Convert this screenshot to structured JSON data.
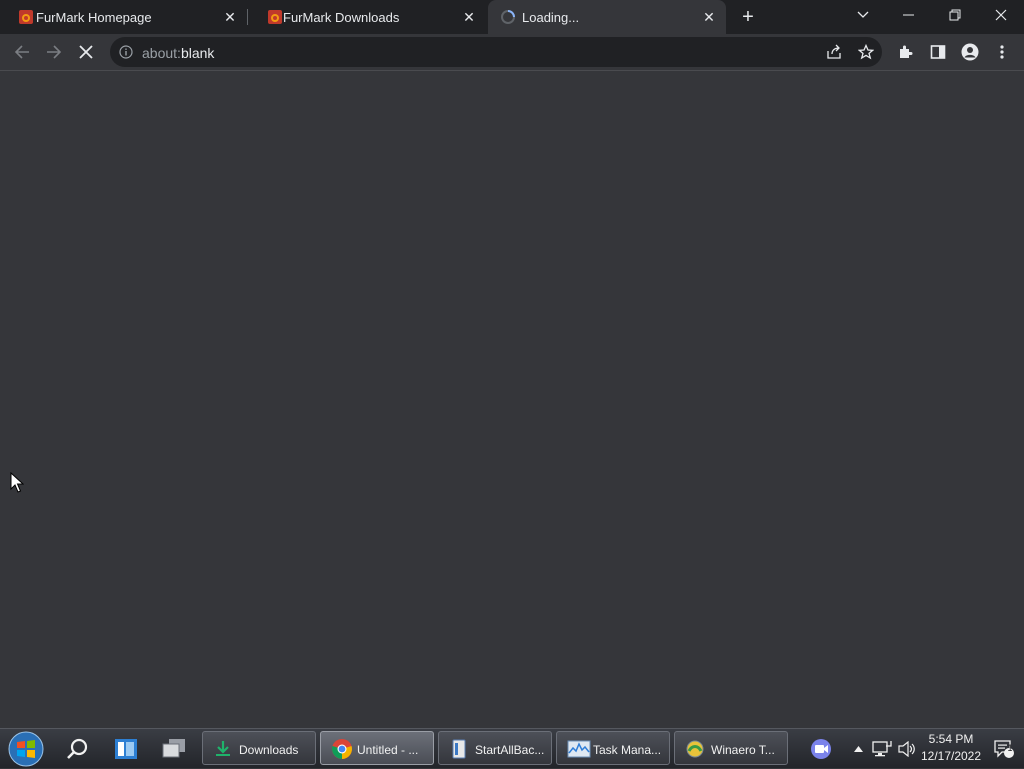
{
  "browser": {
    "tabs": [
      {
        "title": "FurMark Homepage",
        "state": "loaded"
      },
      {
        "title": "FurMark Downloads",
        "state": "loaded"
      },
      {
        "title": "Loading...",
        "state": "loading",
        "active": true
      }
    ],
    "address": {
      "scheme": "about:",
      "rest": "blank"
    },
    "colors": {
      "frame": "#202124",
      "toolbar": "#35363a",
      "text": "#e8eaed"
    }
  },
  "taskbar": {
    "apps": [
      {
        "label": "Downloads",
        "icon": "download-folder-icon"
      },
      {
        "label": "Untitled - ...",
        "icon": "chrome-icon",
        "active": true
      },
      {
        "label": "StartAllBac...",
        "icon": "startallback-icon"
      },
      {
        "label": "Task Mana...",
        "icon": "task-manager-icon"
      },
      {
        "label": "Winaero T...",
        "icon": "winaero-icon"
      }
    ],
    "clock": {
      "time": "5:54 PM",
      "date": "12/17/2022"
    },
    "notification_count": "1"
  }
}
